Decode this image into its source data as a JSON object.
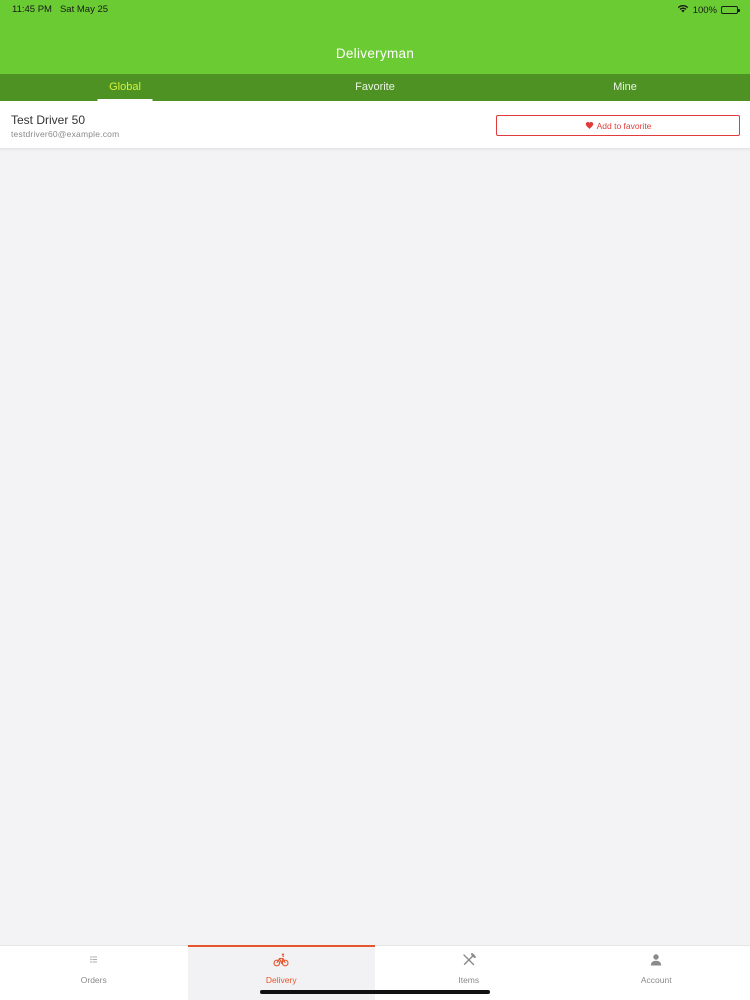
{
  "status_bar": {
    "time": "11:45 PM",
    "date": "Sat May 25",
    "battery": "100%"
  },
  "header": {
    "title": "Deliveryman"
  },
  "tabs": [
    {
      "label": "Global",
      "active": true
    },
    {
      "label": "Favorite",
      "active": false
    },
    {
      "label": "Mine",
      "active": false
    }
  ],
  "drivers": [
    {
      "name": "Test Driver 50",
      "email": "testdriver60@example.com",
      "action_label": "Add to favorite"
    }
  ],
  "bottom_nav": [
    {
      "label": "Orders",
      "icon": "list-icon",
      "active": false
    },
    {
      "label": "Delivery",
      "icon": "bicycle-icon",
      "active": true
    },
    {
      "label": "Items",
      "icon": "utensils-icon",
      "active": false
    },
    {
      "label": "Account",
      "icon": "user-icon",
      "active": false
    }
  ],
  "colors": {
    "primary": "#6bcb33",
    "tab_bar": "#4e9224",
    "accent": "#e4572e",
    "favorite": "#e03c3c",
    "active_tab_text": "#d3f23a"
  }
}
